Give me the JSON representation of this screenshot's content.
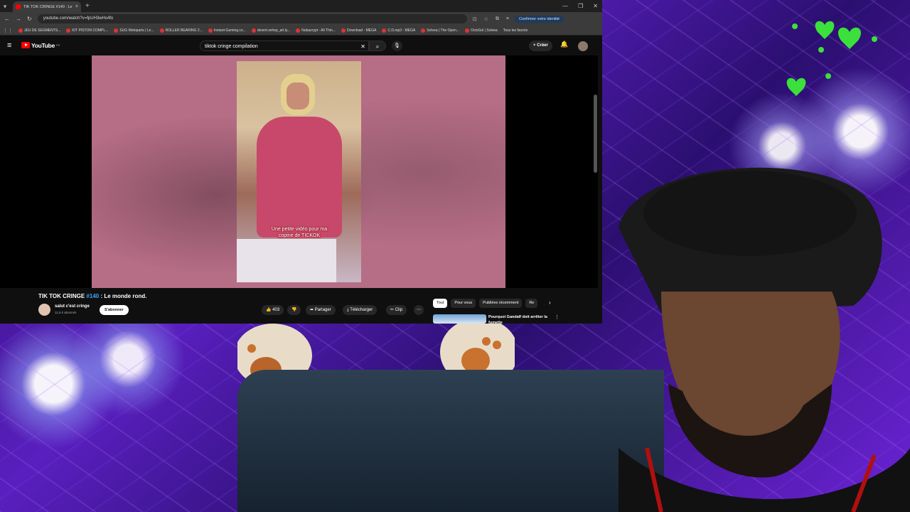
{
  "browser": {
    "tab_title": "TIK TOK CRINGE #140 : Le",
    "url": "youtube.com/watch?v=fpUH3wHs4fo",
    "confirm_label": "Confirmer votre identité",
    "bookmarks": [
      "JEU DE SEGMENTS...",
      "KIT PISTON COMPL...",
      "SUG Motoparts | Le...",
      "ROLLER BEARING 2...",
      "Instant-Gaming.co...",
      "desert.sehep_art.ly...",
      "Nubazrypt - All Thin...",
      "Download - MEGA",
      "C.D.mp3 - MEGA",
      "Solvea | The Open...",
      "OctoGol | Solvea"
    ],
    "all_bookmarks": "Tous les favoris"
  },
  "youtube": {
    "logo_text": "YouTube",
    "country_code": "FR",
    "search_value": "tiktok cringe compilation",
    "create_label": "Créer"
  },
  "video": {
    "caption_line1": "Une petite vidéo pour ma",
    "caption_line2": "copine de TICKOK",
    "title_prefix": "TIK TOK CRINGE ",
    "title_tag": "#140",
    "title_suffix": " : Le monde rond.",
    "channel_name": "salut c'est cringe",
    "subscribers": "11,5 k abonnés",
    "subscribe_label": "S'abonner",
    "likes": "403",
    "share_label": "Partager",
    "download_label": "Télécharger",
    "clip_label": "Clip"
  },
  "recommendations": {
    "chips": [
      "Tout",
      "Pour vous",
      "Publiées récemment",
      "Re"
    ],
    "first_title": "Pourquoi Gandalf doit arrêter la fumette"
  },
  "colors": {
    "accent": "#ff0000",
    "link": "#3ea6ff",
    "overlay_purple": "#5a1fc0"
  }
}
